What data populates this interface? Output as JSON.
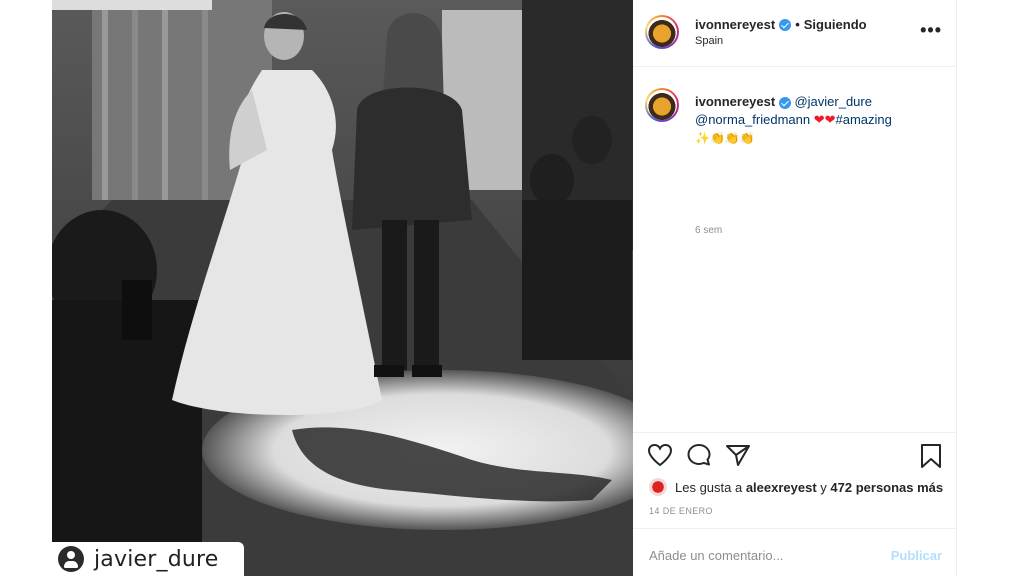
{
  "post": {
    "photo_watermark": "javier_dure",
    "image_icons": [
      "user-silhouette-icon"
    ]
  },
  "header": {
    "username": "ivonnereyest",
    "separator": "•",
    "follow_status": "Siguiendo",
    "location": "Spain",
    "more_icon": "more-horizontal-icon"
  },
  "caption": {
    "username": "ivonnereyest",
    "mention1": "@javier_dure",
    "mention2": "@norma_friedmann",
    "hearts": "❤❤",
    "hashtag": "#amazing",
    "emojis": "✨👏👏👏",
    "time_ago": "6 sem"
  },
  "actions": {
    "icons": [
      "heart-icon",
      "comment-icon",
      "share-icon",
      "bookmark-icon"
    ]
  },
  "likes": {
    "prefix": "Les gusta a ",
    "user": "aleexreyest",
    "middle": " y ",
    "count": "472 personas más"
  },
  "date": "14 DE ENERO",
  "comment_box": {
    "placeholder": "Añade un comentario...",
    "publish": "Publicar"
  },
  "colors": {
    "accent": "#3897f0",
    "mention": "#003569",
    "muted": "#8e8e8e",
    "publish_disabled": "#b2dffc"
  }
}
